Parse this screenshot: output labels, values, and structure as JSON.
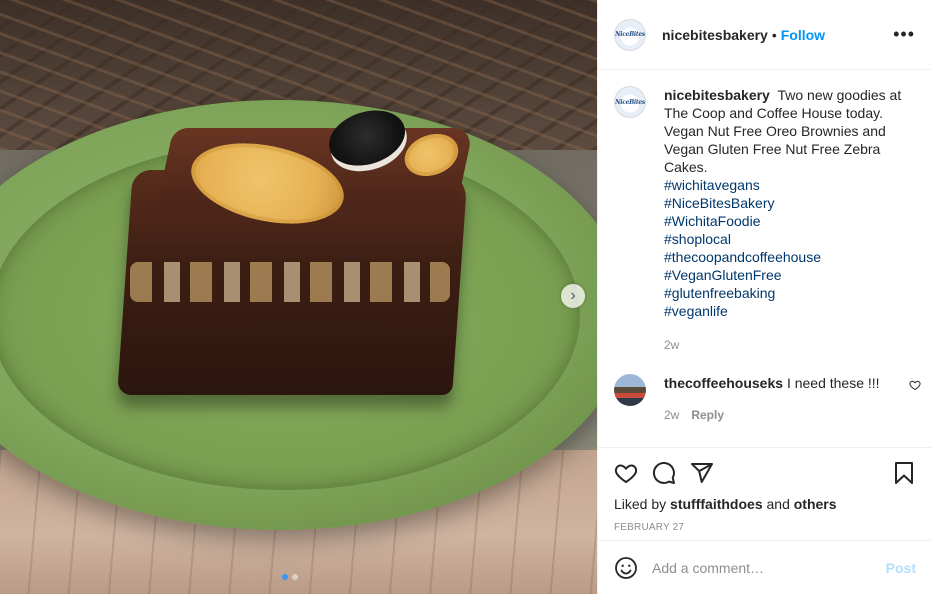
{
  "post": {
    "image_alt": "Brownie with cookies on a green plate",
    "carousel_dots": 2,
    "active_dot": 0
  },
  "header": {
    "username": "nicebitesbakery",
    "separator": "•",
    "follow_label": "Follow",
    "more_label": "•••",
    "avatar_logo_text": "NiceBites"
  },
  "caption": {
    "username": "nicebitesbakery",
    "text": "Two new goodies at The Coop and Coffee House today. Vegan Nut Free Oreo Brownies and Vegan Gluten Free Nut Free Zebra Cakes.",
    "hashtags": [
      "#wichitavegans",
      "#NiceBitesBakery",
      "#WichitaFoodie",
      "#shoplocal",
      "#thecoopandcoffeehouse",
      "#VeganGlutenFree",
      "#glutenfreebaking",
      "#veganlife"
    ],
    "time": "2w"
  },
  "comment": {
    "username": "thecoffeehouseks",
    "text": "I need these !!!",
    "time": "2w",
    "reply_label": "Reply"
  },
  "actions": {
    "liked_by_prefix": "Liked by",
    "liked_by_user": "stufffaithdoes",
    "liked_by_and": "and",
    "liked_by_others": "others",
    "date": "FEBRUARY 27"
  },
  "add_comment": {
    "placeholder": "Add a comment…",
    "post_label": "Post"
  },
  "colors": {
    "accent": "#0095f6",
    "hashtag": "#00376b",
    "muted": "#8e8e8e",
    "post_disabled": "#b2dffc",
    "plate": "#7fa55a"
  }
}
